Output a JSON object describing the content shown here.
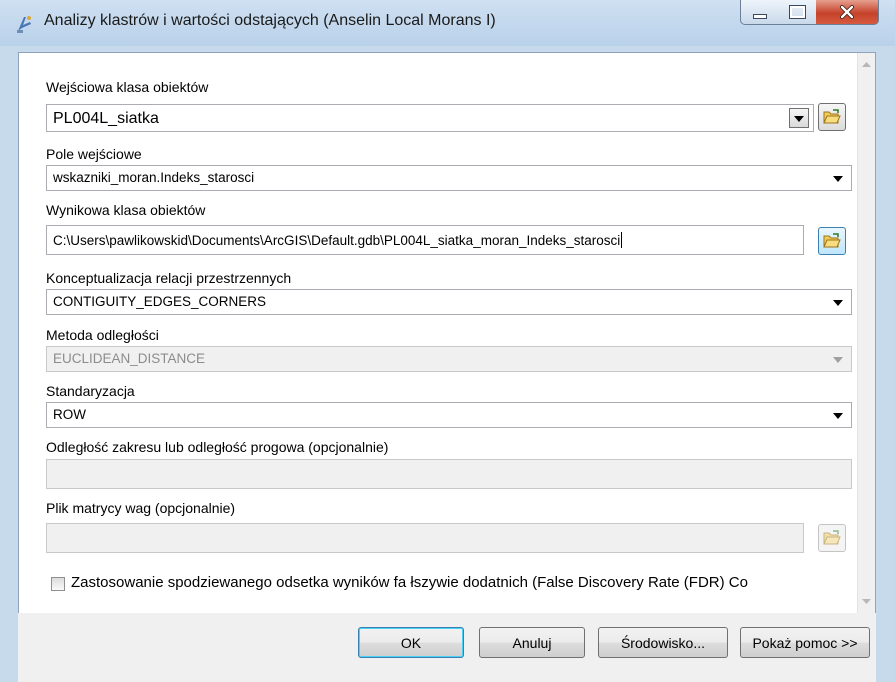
{
  "window": {
    "title": "Analizy klastrów i wartości odstających (Anselin Local Morans I)",
    "icon": "arcgis-tool-icon"
  },
  "form": {
    "input_class": {
      "label": "Wejściowa klasa obiektów",
      "value": "PL004L_siatka"
    },
    "input_field": {
      "label": "Pole wejściowe",
      "value": "wskazniki_moran.Indeks_starosci"
    },
    "output_class": {
      "label": "Wynikowa klasa obiektów",
      "value": "C:\\Users\\pawlikowskid\\Documents\\ArcGIS\\Default.gdb\\PL004L_siatka_moran_Indeks_starosci"
    },
    "conceptualization": {
      "label": "Konceptualizacja relacji przestrzennych",
      "value": "CONTIGUITY_EDGES_CORNERS"
    },
    "distance_method": {
      "label": "Metoda odległości",
      "value": "EUCLIDEAN_DISTANCE"
    },
    "standardization": {
      "label": "Standaryzacja",
      "value": "ROW"
    },
    "distance_band": {
      "label": "Odległość zakresu lub odległość progowa (opcjonalnie)",
      "value": ""
    },
    "weights_file": {
      "label": "Plik matrycy wag (opcjonalnie)",
      "value": ""
    },
    "fdr": {
      "label": "Zastosowanie spodziewanego odsetka wyników fa łszywie dodatnich (False Discovery Rate (FDR) Co",
      "checked": false
    }
  },
  "buttons": {
    "ok": "OK",
    "cancel": "Anuluj",
    "environments": "Środowisko...",
    "show_help": "Pokaż pomoc >>"
  },
  "colors": {
    "titlebar": "#b9d1ea",
    "close_button": "#c5422b",
    "folder_icon": "#e8b83a"
  }
}
